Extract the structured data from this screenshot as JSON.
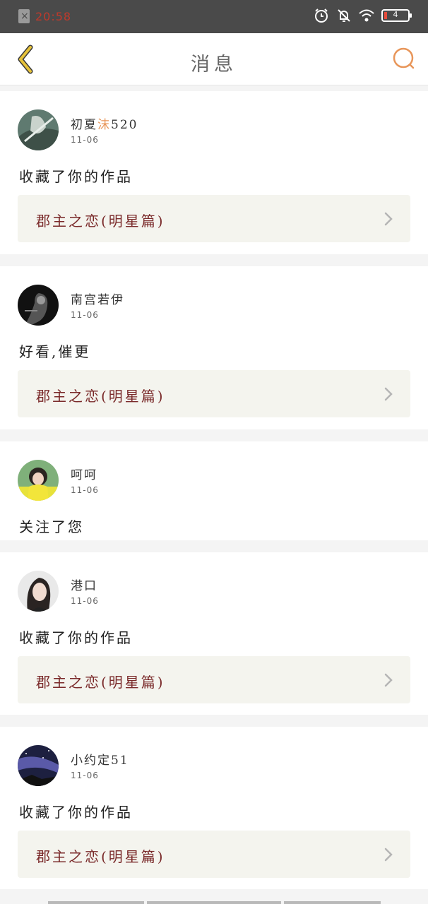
{
  "status_bar": {
    "time": "20:58",
    "battery_percent": "4"
  },
  "nav": {
    "title": "消息"
  },
  "messages": [
    {
      "username_prefix": "初夏",
      "username_highlight": "沫",
      "username_suffix": "520",
      "date": "11-06",
      "text": "收藏了你的作品",
      "work_title": "郡主之恋(明星篇)"
    },
    {
      "username": "南宫若伊",
      "date": "11-06",
      "text": "好看,催更",
      "work_title": "郡主之恋(明星篇)"
    },
    {
      "username": "呵呵",
      "date": "11-06",
      "text": "关注了您"
    },
    {
      "username": "港口",
      "date": "11-06",
      "text": "收藏了你的作品",
      "work_title": "郡主之恋(明星篇)"
    },
    {
      "username": "小约定51",
      "date": "11-06",
      "text": "收藏了你的作品",
      "work_title": "郡主之恋(明星篇)"
    }
  ],
  "colors": {
    "accent_orange": "#e8965a",
    "back_arrow": "#e6c23a",
    "work_title": "#7a2a2a",
    "status_time": "#c0392b"
  },
  "icons": {
    "back": "chevron-left-icon",
    "search": "search-icon",
    "work_arrow": "chevron-right-icon"
  }
}
